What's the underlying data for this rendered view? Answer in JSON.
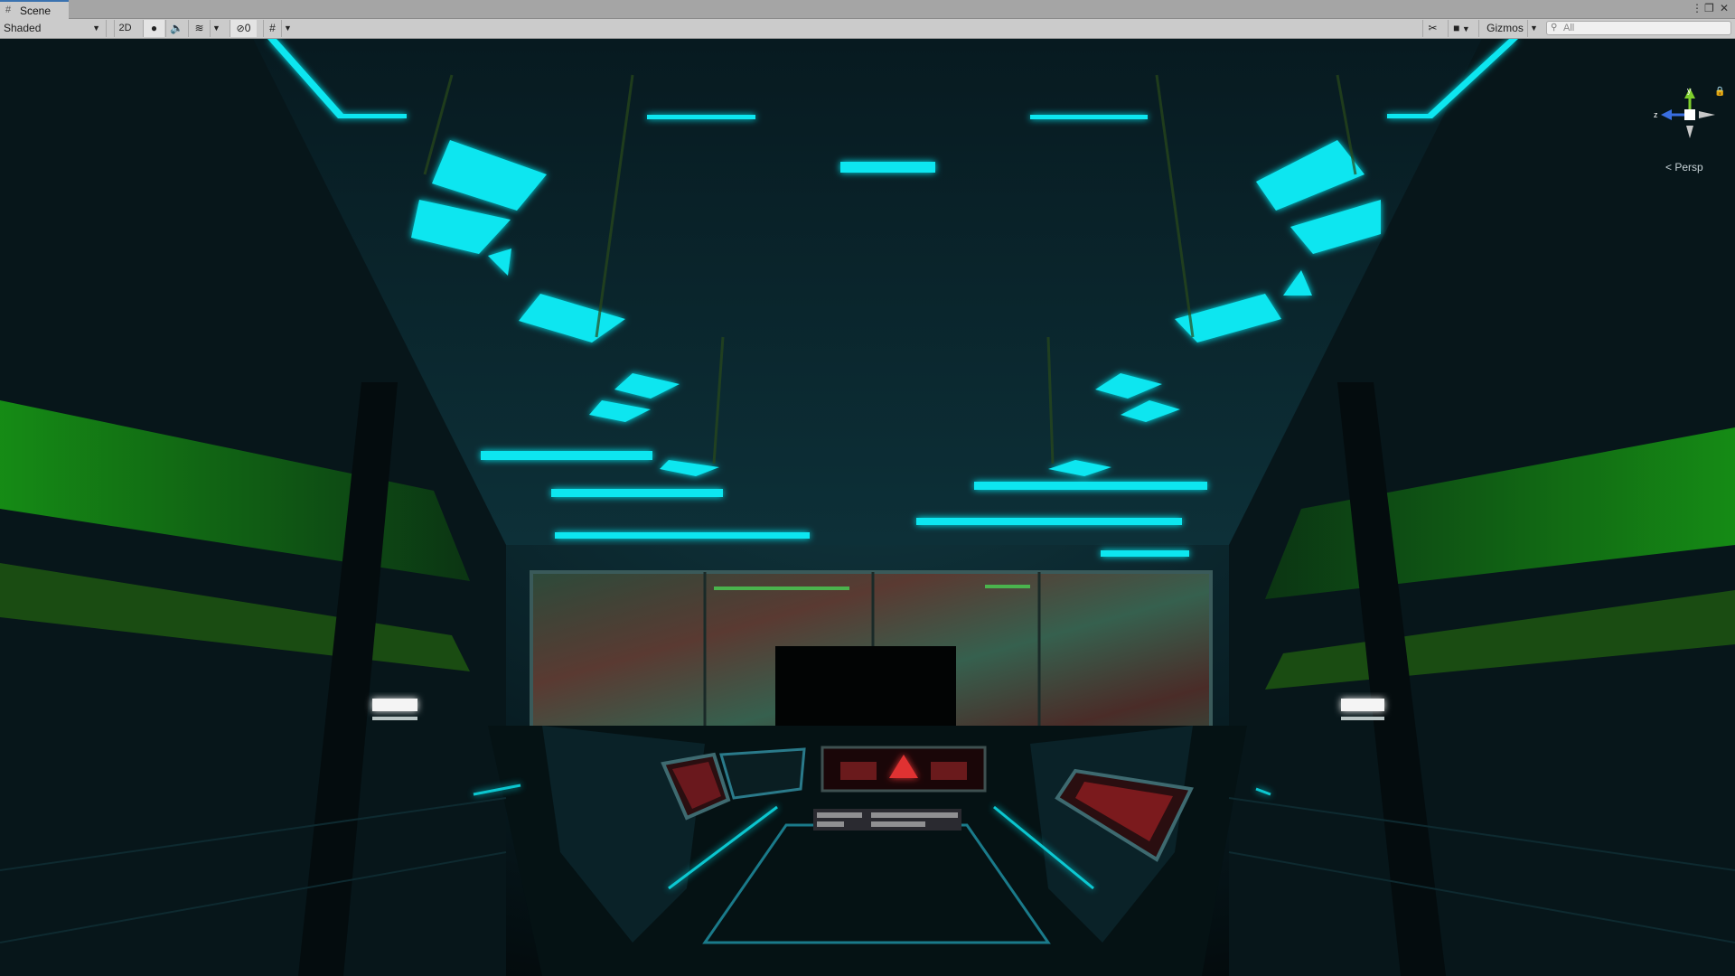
{
  "window": {
    "tab_label": "Scene",
    "tab_icon": "grid-icon"
  },
  "toolbar": {
    "draw_mode": "Shaded",
    "mode_2d": "2D",
    "hidden_count": "0",
    "gizmos_label": "Gizmos",
    "search_placeholder": "All"
  },
  "viewport": {
    "projection_label": "< Persp",
    "axis_y": "y",
    "axis_z": "z"
  },
  "colors": {
    "accent_tab": "#3a72b0",
    "neon_cyan": "#10e6f0",
    "neon_green": "#29c21a",
    "screen_red": "#c8202a"
  }
}
